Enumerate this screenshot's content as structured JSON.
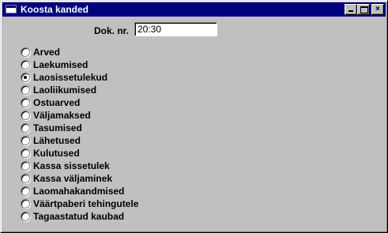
{
  "window": {
    "title": "Koosta kanded",
    "icon": "window-icon",
    "buttons": {
      "minimize": "minimize-icon",
      "maximize": "maximize-icon",
      "close": "×"
    }
  },
  "form": {
    "doc_label": "Dok. nr.",
    "doc_value": "20:30"
  },
  "options": [
    {
      "label": "Arved",
      "checked": false
    },
    {
      "label": "Laekumised",
      "checked": false
    },
    {
      "label": "Laosissetulekud",
      "checked": true
    },
    {
      "label": "Laoliikumised",
      "checked": false
    },
    {
      "label": "Ostuarved",
      "checked": false
    },
    {
      "label": "Väljamaksed",
      "checked": false
    },
    {
      "label": "Tasumised",
      "checked": false
    },
    {
      "label": "Lähetused",
      "checked": false
    },
    {
      "label": "Kulutused",
      "checked": false
    },
    {
      "label": "Kassa sissetulek",
      "checked": false
    },
    {
      "label": "Kassa väljaminek",
      "checked": false
    },
    {
      "label": "Laomahakandmised",
      "checked": false
    },
    {
      "label": "Väärtpaberi tehingutele",
      "checked": false
    },
    {
      "label": "Tagaastatud kaubad",
      "checked": false
    }
  ]
}
